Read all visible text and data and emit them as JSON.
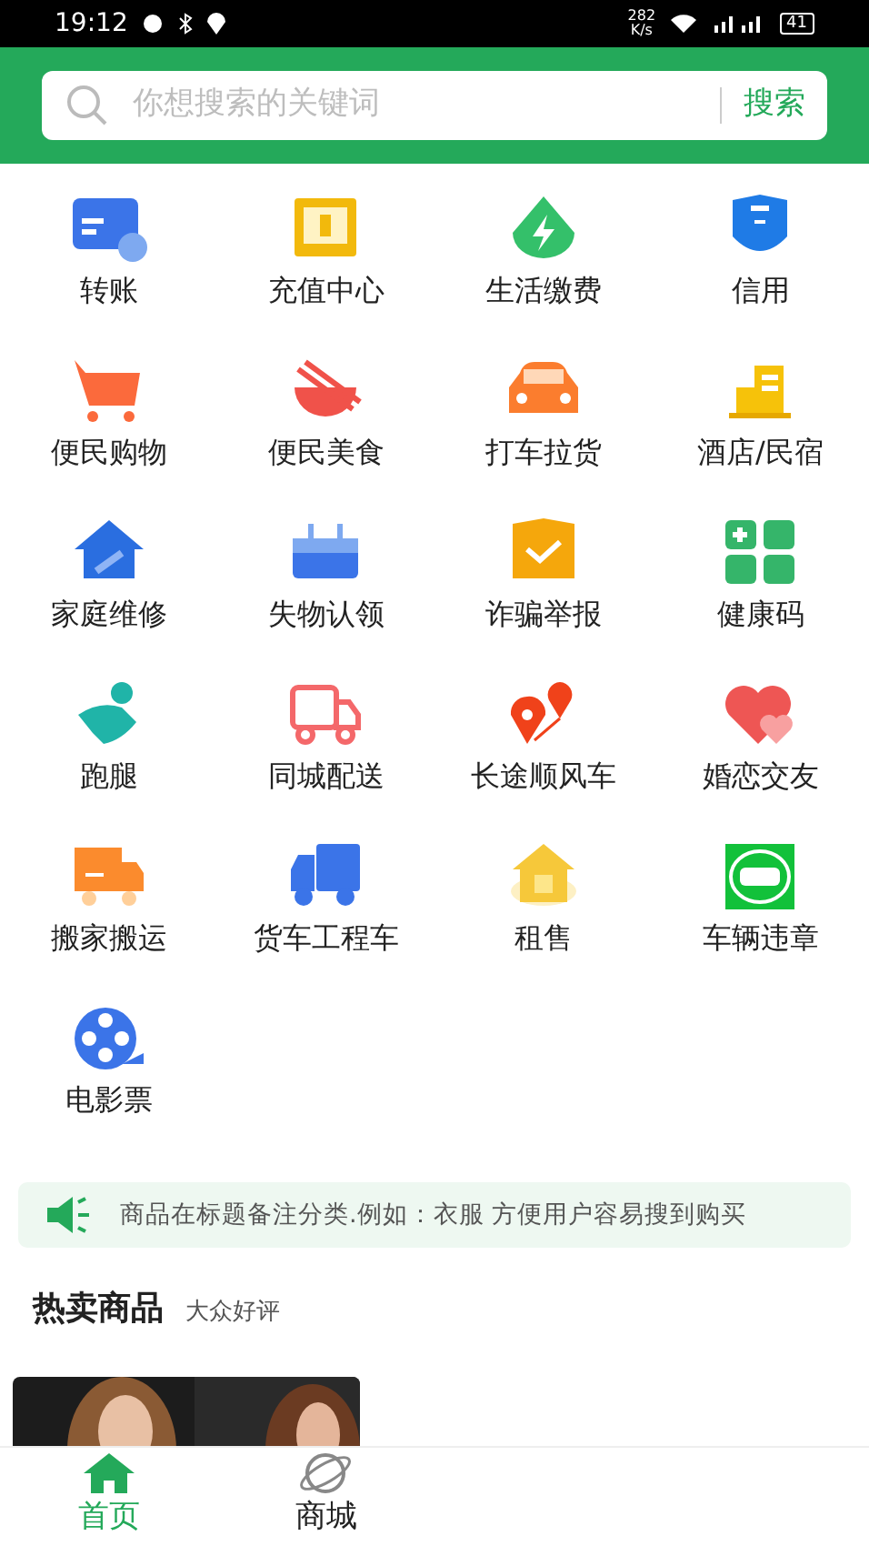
{
  "status_bar": {
    "time": "19:12",
    "speed": "282",
    "speed_unit": "K/s",
    "battery": "41"
  },
  "search": {
    "placeholder": "你想搜索的关键词",
    "button": "搜索"
  },
  "services": [
    {
      "label": "转账"
    },
    {
      "label": "充值中心"
    },
    {
      "label": "生活缴费"
    },
    {
      "label": "信用"
    },
    {
      "label": "便民购物"
    },
    {
      "label": "便民美食"
    },
    {
      "label": "打车拉货"
    },
    {
      "label": "酒店/民宿"
    },
    {
      "label": "家庭维修"
    },
    {
      "label": "失物认领"
    },
    {
      "label": "诈骗举报"
    },
    {
      "label": "健康码"
    },
    {
      "label": "跑腿"
    },
    {
      "label": "同城配送"
    },
    {
      "label": "长途顺风车"
    },
    {
      "label": "婚恋交友"
    },
    {
      "label": "搬家搬运"
    },
    {
      "label": "货车工程车"
    },
    {
      "label": "租售"
    },
    {
      "label": "车辆违章"
    },
    {
      "label": "电影票"
    }
  ],
  "notice": {
    "text": "商品在标题备注分类.例如：衣服 方便用户容易搜到购买"
  },
  "section": {
    "title": "热卖商品",
    "subtitle": "大众好评"
  },
  "bottom_nav": [
    {
      "label": "首页",
      "selected": true
    },
    {
      "label": "商城",
      "selected": false
    }
  ]
}
